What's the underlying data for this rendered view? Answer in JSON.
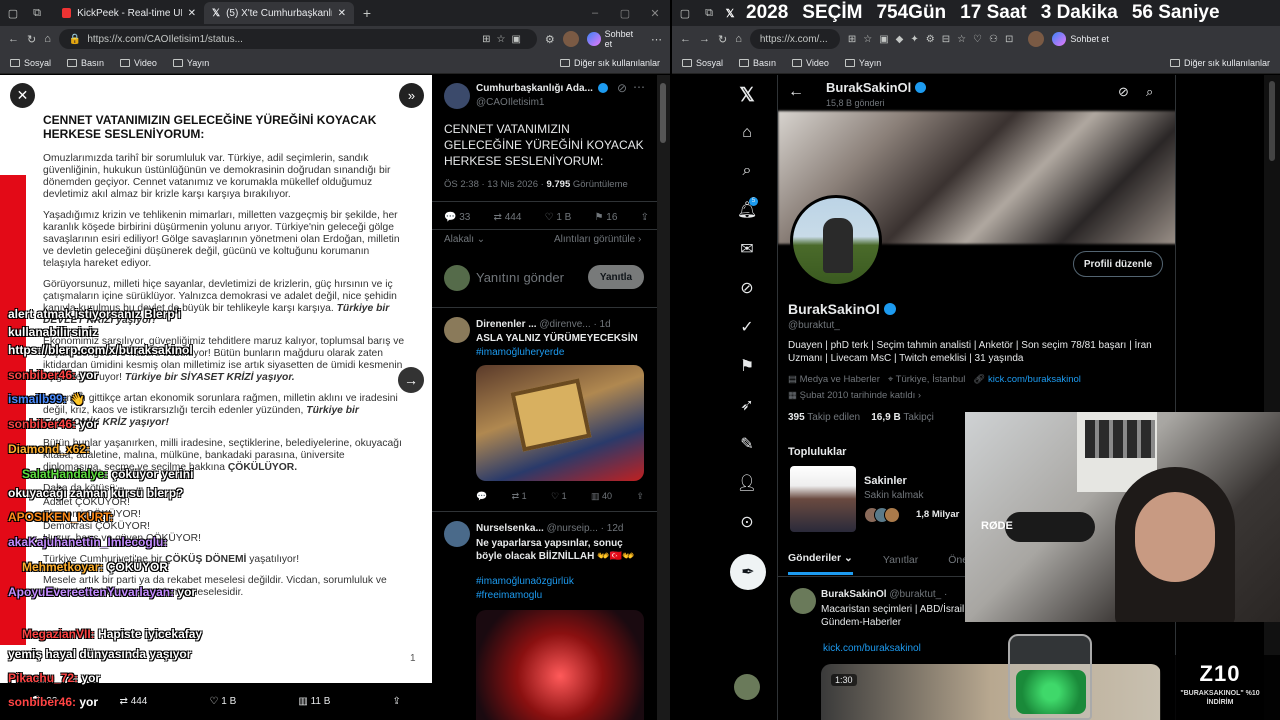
{
  "left_window": {
    "tabs": [
      "KickPeek - Real-time URL Crawler",
      "(5) X'te Cumhurbaşkanlığı Aday O..."
    ],
    "url": "https://x.com/CAOIletisim1/status...",
    "copilot": "Sohbet et",
    "bookmarks": [
      "Sosyal",
      "Basın",
      "Video",
      "Yayın"
    ],
    "bookmarks_other": "Diğer sık kullanılanlar"
  },
  "right_window": {
    "countdown": {
      "year": "2028",
      "label": "SEÇİM",
      "days": "754Gün",
      "hours": "17 Saat",
      "minutes": "3 Dakika",
      "seconds": "56 Saniye"
    },
    "url": "https://x.com/...",
    "copilot": "Sohbet et",
    "bookmarks": [
      "Sosyal",
      "Basın",
      "Video",
      "Yayın"
    ],
    "bookmarks_other": "Diğer sık kullanılanlar"
  },
  "document": {
    "title": "CENNET VATANIMIZIN GELECEĞİNE YÜREĞİNİ KOYACAK HERKESE SESLENİYORUM:",
    "p1": "Omuzlarımızda tarihî bir sorumluluk var. Türkiye, adil seçimlerin, sandık güvenliğinin, hukukun üstünlüğünün ve demokrasinin doğrudan sınandığı bir dönemden geçiyor. Cennet vatanımız ve korumakla mükellef olduğumuz devletimiz akıl almaz bir krizle karşı karşıya bırakılıyor.",
    "p2": "Yaşadığımız krizin ve tehlikenin mimarları, milletten vazgeçmiş bir şekilde, her karanlık köşede birbirini düşürmenin yolunu arıyor. Türkiye'nin geleceği gölge savaşlarının esiri ediliyor! Gölge savaşlarının yönetmeni olan Erdoğan, milletin ve devletin geleceğini düşünerek değil, gücünü ve koltuğunu korumanın telaşıyla hareket ediyor.",
    "p3": "Görüyorsunuz, milleti hiçe sayanlar, devletimizi de krizlerin, güç hırsının ve iç çatışmaların içine sürüklüyor. Yalnızca demokrasi ve adalet değil, nice şehidin kanıyla kurulmuş bu devlet de büyük bir tehlikeyle karşı karşıya.",
    "p3_bold": "Türkiye bir DEVLET KRİZİ yaşıyor!",
    "p4": "Ekonomimiz sarsılıyor, güvenliğimiz tehditlere maruz kalıyor, toplumsal barış ve yaşam dengesi ve huzuru bozuluyor! Bütün bunların mağduru olarak zaten iktidardan ümidini kesmiş olan milletimiz ise artık siyasetten de ümidi kesmenin eşiğinde duruyor!",
    "p4_bold": "Türkiye bir SİYASET KRİZİ yaşıyor.",
    "p5": "Halkımızı gittikçe artan ekonomik sorunlara rağmen, milletin aklını ve iradesini değil, kriz, kaos ve istikrarsızlığı tercih edenler yüzünden,",
    "p5_bold": "Türkiye bir EKONOMİK KRİZ yaşıyor!",
    "p6": "Bütün bunlar yaşanırken, milli iradesine, seçtiklerine, belediyelerine, okuyacağı kitaba, adaletine, malına, mülküne, bankadaki parasına, üniversite diplomasına, seçme ve seçilme hakkına",
    "p6_bold": "ÇÖKÜLÜYOR.",
    "list_intro": "Daha da kötüsü:",
    "list": [
      "Adalet ÇÖKÜYOR!",
      "Ekonomi ÇÖKÜYOR!",
      "Demokrasi ÇÖKÜYOR!",
      "Huzur, barış ve güven ÇÖKÜYOR!"
    ],
    "p7": "Türkiye Cumhuriyeti'ne bir",
    "p7_bold": "ÇÖKÜŞ DÖNEMİ",
    "p7_end": "yaşatılıyor!",
    "p8": "Mesele artık bir parti ya da rekabet meselesi değildir. Vicdan, sorumluluk ve millete karşı borcumuzu ödeme meselesidir.",
    "page_num": "1",
    "stats": [
      "33",
      "444",
      "1 B",
      "11 B"
    ]
  },
  "tweet_panel": {
    "author": "Cumhurbaşkanlığı Ada...",
    "handle": "@CAOIletisim1",
    "text": "CENNET VATANIMIZIN GELECEĞİNE YÜREĞİNİ KOYACAK HERKESE SESLENİYORUM:",
    "meta": "ÖS 2:38 · 13 Nis 2026 ·",
    "views": "9.795",
    "views_label": "Görüntüleme",
    "stats": [
      "33",
      "444",
      "1 B",
      "16"
    ],
    "sort": "Alakalı",
    "quotes": "Alıntıları görüntüle",
    "reply_placeholder": "Yanıtını gönder",
    "reply_btn": "Yanıtla",
    "replies": [
      {
        "name": "Direnenler ...",
        "handle": "@direnve...",
        "time": "1d",
        "text": "ASLA YALNIZ YÜRÜMEYECEKSİN",
        "tag": "#imamoğluheryerde",
        "stats": [
          "",
          "1",
          "1",
          "40"
        ]
      },
      {
        "name": "Nurselsenka...",
        "handle": "@nurseip...",
        "time": "12d",
        "text": "Ne yaparlarsa yapsınlar, sonuç böyle olacak BİİZNİLLAH 👐🇹🇷👐",
        "tags": [
          "#imamoğlunaözgürlük",
          "#freeimamoglu"
        ]
      }
    ]
  },
  "chat": [
    {
      "user": "alert atmak istiyorsanız Blerp'i",
      "text": "",
      "color": "#ffffff"
    },
    {
      "user": "kullanabilirsiniz",
      "text": "",
      "color": "#ffffff"
    },
    {
      "user": "https://blerp.com/x/buraksakinol",
      "text": "",
      "color": "#ffffff"
    },
    {
      "user": "sonbiber46:",
      "text": "yor",
      "color": "#ff4444"
    },
    {
      "user": "ismailb99:",
      "text": "👋",
      "color": "#4a8cff"
    },
    {
      "user": "sonbiber46:",
      "text": "yor",
      "color": "#ff4444"
    },
    {
      "user": "Diamond_x62:",
      "text": "",
      "color": "#ffb02e"
    },
    {
      "user": "SalatHandalye:",
      "text": "çöküyor yerini",
      "color": "#5ddf3f"
    },
    {
      "user": "okuyacağı zaman kürsü blerp?",
      "text": "",
      "color": "#ffffff"
    },
    {
      "user": "APOSIKEN_KURT:",
      "text": "",
      "color": "#ff8c1a"
    },
    {
      "user": "akaKajuhanettin_Imlecoglu:",
      "text": "",
      "color": "#c38cff"
    },
    {
      "user": "Mehmetkoyar:",
      "text": "ÇÖKÜYOR",
      "color": "#ffb02e"
    },
    {
      "user": "ApoyuEvereettenYuvarlayan:",
      "text": "yor",
      "color": "#c38cff"
    },
    {
      "user": "MegazianVII:",
      "text": "Hapiste iyicekafay",
      "color": "#ff4444"
    },
    {
      "user": "yemiş hayal dünyasında yaşıyor",
      "text": "",
      "color": "#ffffff"
    },
    {
      "user": "Pikachu_72:",
      "text": "yor",
      "color": "#ff4444"
    },
    {
      "user": "sonbiber46:",
      "text": "yor",
      "color": "#ff4444"
    }
  ],
  "profile": {
    "top_name": "BurakSakinOl",
    "post_count": "15,8 B gönderi",
    "name": "BurakSakinOl",
    "handle": "@buraktut_",
    "edit_btn": "Profili düzenle",
    "bio": "Duayen | phD terk | Seçim tahmin analisti | Anketör | Son seçim 78/81 başarı | İran Uzmanı | Livecam MsC | Twitch emeklisi | 31 yaşında",
    "category": "Medya ve Haberler",
    "location": "Türkiye, İstanbul",
    "link": "kick.com/buraksakinol",
    "joined": "Şubat 2010 tarihinde katıldı",
    "following": "395",
    "following_label": "Takip edilen",
    "followers": "16,9 B",
    "followers_label": "Takipçi",
    "communities_title": "Topluluklar",
    "community_name": "Sakinler",
    "community_desc": "Sakin kalmak",
    "community_count": "1,8 Milyar",
    "tabs": [
      "Gönderiler",
      "Yanıtlar",
      "Öne Ç"
    ],
    "post_name": "BurakSakinOl",
    "post_handle": "@buraktut_ ·",
    "post_text": "Macaristan seçimleri | ABD/İsrail Gündem-Haberler",
    "post_link": "kick.com/buraksakinol",
    "video_time": "1:30"
  },
  "overlay": {
    "mic_brand": "RØDE",
    "logo": "Z10",
    "promo": "\"BURAKSAKINOL\" %10 İNDİRİM"
  }
}
